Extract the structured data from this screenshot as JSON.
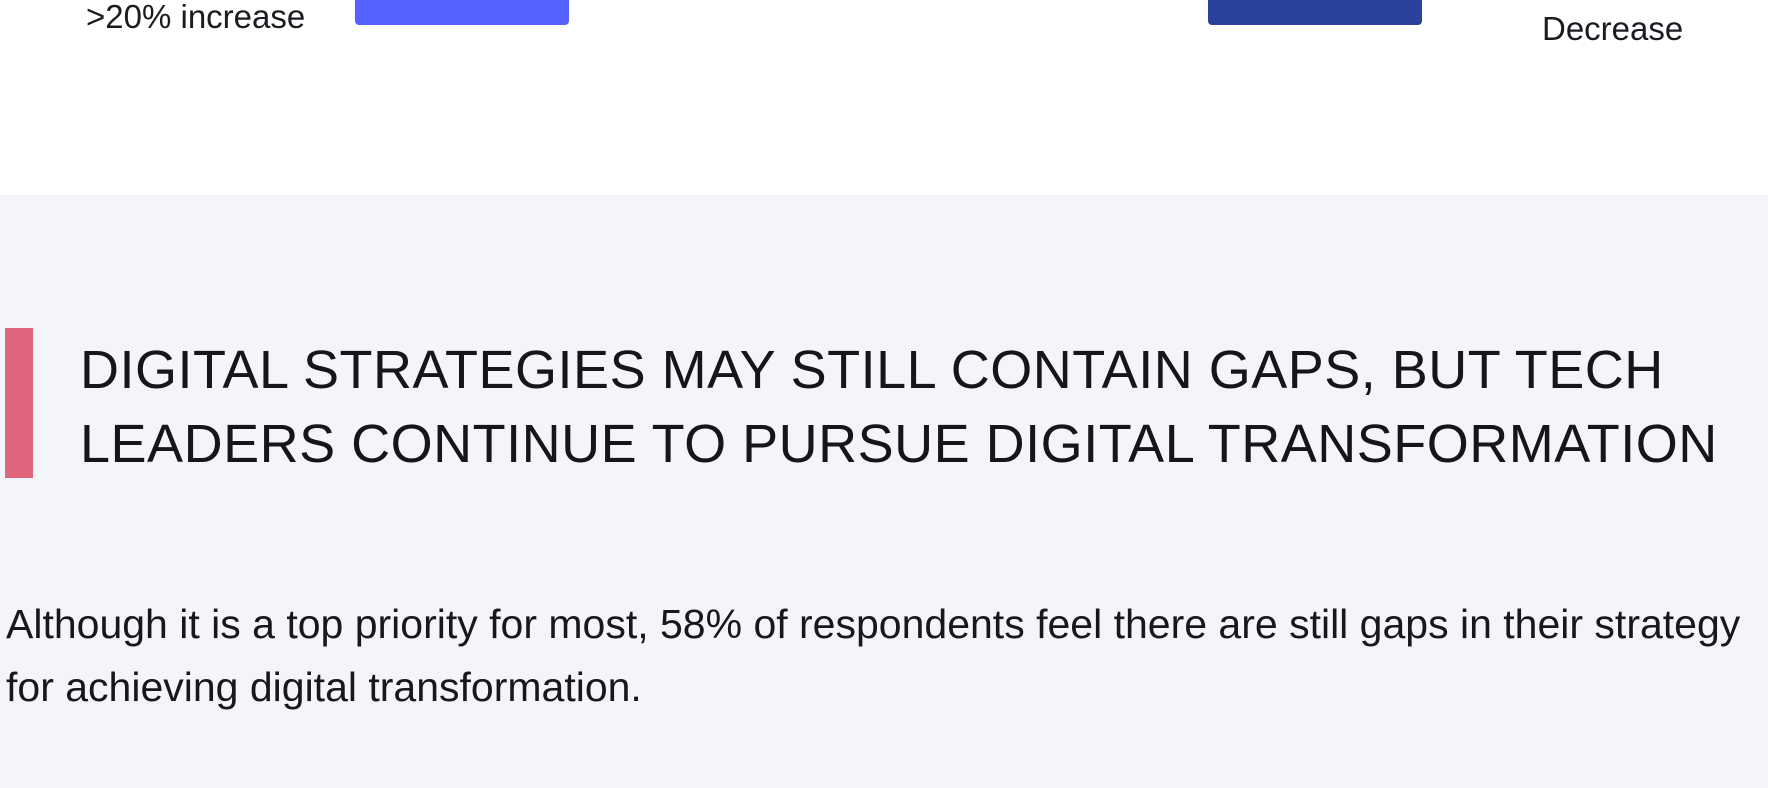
{
  "legend": {
    "increase_label": ">20% increase",
    "decrease_label": "Decrease",
    "increase_color": "#5562ff",
    "decrease_color": "#2b429c"
  },
  "section": {
    "background": "#f4f5f9",
    "accent_color": "#e0647c",
    "heading": "DIGITAL STRATEGIES MAY STILL CONTAIN GAPS, BUT TECH LEADERS CONTINUE TO PURSUE DIGITAL TRANSFORMATION",
    "body": "Although it is a top priority for most, 58% of respondents feel there are still gaps in their strategy for achieving digital transformation."
  }
}
